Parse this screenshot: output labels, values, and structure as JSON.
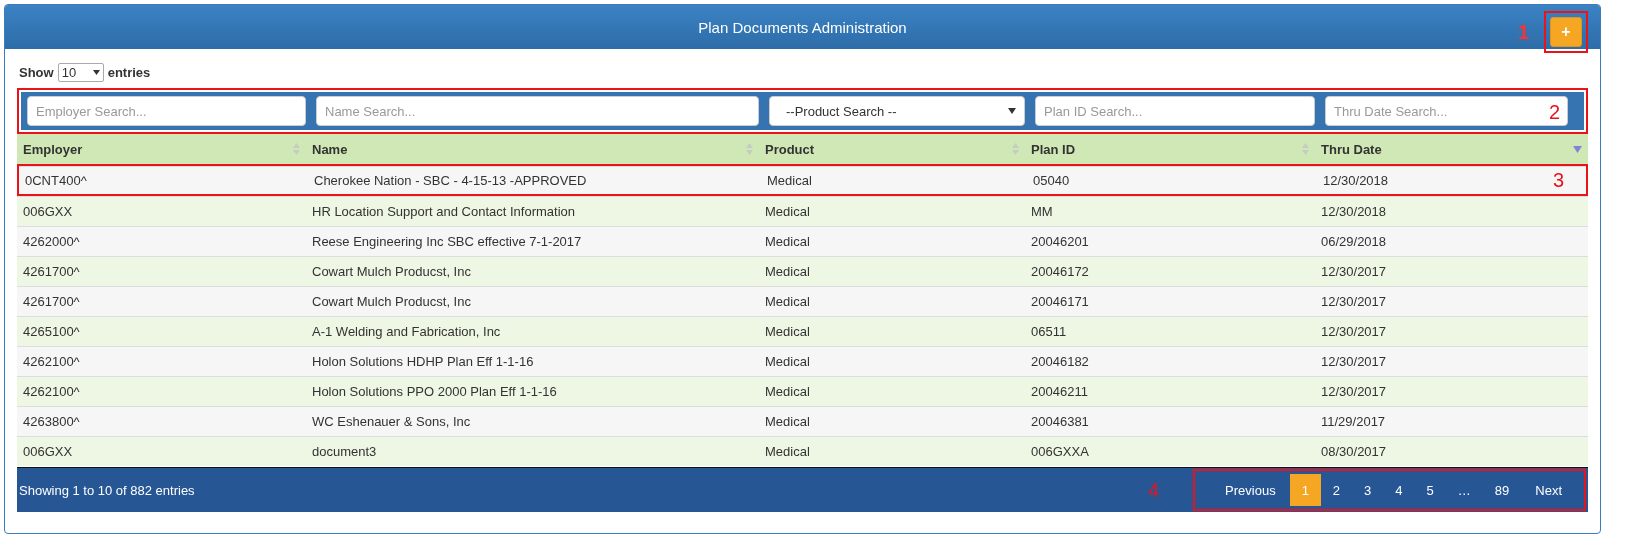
{
  "header": {
    "title": "Plan Documents Administration",
    "add_button": {
      "label": "+",
      "callout": "1"
    }
  },
  "length_menu": {
    "prefix": "Show",
    "value": "10",
    "suffix": "entries"
  },
  "filters": {
    "callout": "2",
    "fields": [
      {
        "kind": "text",
        "placeholder": "Employer Search..."
      },
      {
        "kind": "text",
        "placeholder": "Name Search..."
      },
      {
        "kind": "select",
        "value": "--Product Search --"
      },
      {
        "kind": "text",
        "placeholder": "Plan ID Search..."
      },
      {
        "kind": "text",
        "placeholder": "Thru Date Search..."
      }
    ]
  },
  "table": {
    "columns": [
      {
        "label": "Employer",
        "sorted": false
      },
      {
        "label": "Name",
        "sorted": false
      },
      {
        "label": "Product",
        "sorted": false
      },
      {
        "label": "Plan ID",
        "sorted": false
      },
      {
        "label": "Thru Date",
        "sorted": true
      }
    ],
    "rows": [
      {
        "cells": [
          "0CNT400^",
          "Cherokee Nation - SBC - 4-15-13 -APPROVED",
          "Medical",
          "05040",
          "12/30/2018"
        ],
        "callout": "3"
      },
      {
        "cells": [
          "006GXX",
          "HR Location Support and Contact Information",
          "Medical",
          "MM",
          "12/30/2018"
        ]
      },
      {
        "cells": [
          "4262000^",
          "Reese Engineering Inc SBC effective 7-1-2017",
          "Medical",
          "20046201",
          "06/29/2018"
        ]
      },
      {
        "cells": [
          "4261700^",
          "Cowart Mulch Producst, Inc",
          "Medical",
          "20046172",
          "12/30/2017"
        ]
      },
      {
        "cells": [
          "4261700^",
          "Cowart Mulch Producst, Inc",
          "Medical",
          "20046171",
          "12/30/2017"
        ]
      },
      {
        "cells": [
          "4265100^",
          "A-1 Welding and Fabrication, Inc",
          "Medical",
          "06511",
          "12/30/2017"
        ]
      },
      {
        "cells": [
          "4262100^",
          "Holon Solutions HDHP Plan Eff 1-1-16",
          "Medical",
          "20046182",
          "12/30/2017"
        ]
      },
      {
        "cells": [
          "4262100^",
          "Holon Solutions PPO 2000 Plan Eff 1-1-16",
          "Medical",
          "20046211",
          "12/30/2017"
        ]
      },
      {
        "cells": [
          "4263800^",
          "WC Eshenauer & Sons, Inc",
          "Medical",
          "20046381",
          "11/29/2017"
        ]
      },
      {
        "cells": [
          "006GXX",
          "document3",
          "Medical",
          "006GXXA",
          "08/30/2017"
        ]
      }
    ]
  },
  "footer": {
    "info": "Showing 1 to 10 of 882 entries",
    "pagination": {
      "callout": "4",
      "items": [
        {
          "label": "Previous",
          "kind": "nav",
          "selected": false
        },
        {
          "label": "1",
          "kind": "page",
          "selected": true
        },
        {
          "label": "2",
          "kind": "page",
          "selected": false
        },
        {
          "label": "3",
          "kind": "page",
          "selected": false
        },
        {
          "label": "4",
          "kind": "page",
          "selected": false
        },
        {
          "label": "5",
          "kind": "page",
          "selected": false
        },
        {
          "label": "…",
          "kind": "ellipsis",
          "selected": false
        },
        {
          "label": "89",
          "kind": "page",
          "selected": false
        },
        {
          "label": "Next",
          "kind": "nav",
          "selected": false
        }
      ]
    }
  }
}
